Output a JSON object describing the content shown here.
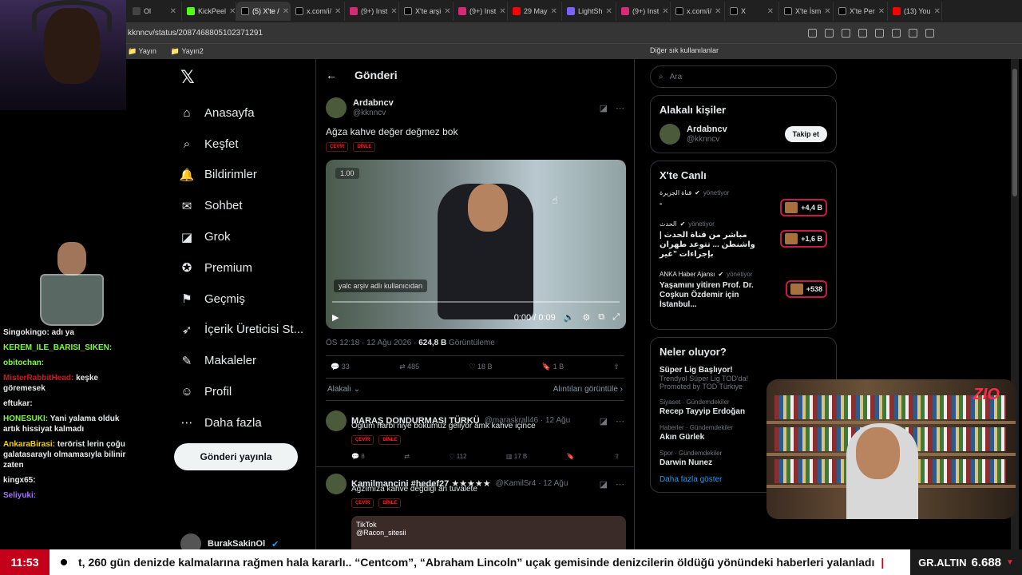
{
  "tabs": [
    {
      "label": "Ol",
      "color": "#444"
    },
    {
      "label": "KickPeel",
      "color": "#53fc18"
    },
    {
      "label": "(5) X'te /",
      "color": "#000",
      "active": true
    },
    {
      "label": "x.com/i/",
      "color": "#000"
    },
    {
      "label": "(9+) Inst",
      "color": "#d62976"
    },
    {
      "label": "X'te arşi",
      "color": "#000"
    },
    {
      "label": "(9+) Inst",
      "color": "#d62976"
    },
    {
      "label": "29 May",
      "color": "#ff0000"
    },
    {
      "label": "LightSh",
      "color": "#7b61ff"
    },
    {
      "label": "(9+) Inst",
      "color": "#d62976"
    },
    {
      "label": "x.com/i/",
      "color": "#000"
    },
    {
      "label": "X",
      "color": "#000"
    },
    {
      "label": "X'te İsm",
      "color": "#000"
    },
    {
      "label": "X'te Per",
      "color": "#000"
    },
    {
      "label": "(13) You",
      "color": "#ff0000"
    }
  ],
  "url": "kknncv/status/2087468805102371291",
  "bookmarks": [
    "Yayın",
    "Yayın2"
  ],
  "bookmarks_right": "Diğer sık kullanılanlar",
  "chat": [
    {
      "user": "Singokingo:",
      "text": "adı ya",
      "color": "#e7e9ea"
    },
    {
      "user": "KEREM_ILE_BARISI_SIKEN:",
      "text": "",
      "color": "#7dfc3a"
    },
    {
      "user": "obitochan:",
      "text": "",
      "color": "#7dfc3a"
    },
    {
      "user": "MisterRabbitHead:",
      "text": "keşke göremesek",
      "color": "#d0191f"
    },
    {
      "user": "eftukar:",
      "text": "",
      "color": "#e7e9ea"
    },
    {
      "user": "HONESUKI:",
      "text": "Yani yalama olduk artık hissiyat kalmadı",
      "color": "#7dfc3a"
    },
    {
      "user": "AnkaraBirasi:",
      "text": "terörist lerin çoğu galatasaraylı olmamasıyla bilinir zaten",
      "color": "#f5d000"
    },
    {
      "user": "kingx65:",
      "text": "",
      "color": "#e7e9ea"
    },
    {
      "user": "Seliyuki:",
      "text": "",
      "color": "#a970ff"
    }
  ],
  "nav": [
    {
      "label": "Anasayfa",
      "icon": "⌂",
      "name": "home"
    },
    {
      "label": "Keşfet",
      "icon": "⌕",
      "name": "explore"
    },
    {
      "label": "Bildirimler",
      "icon": "🔔",
      "name": "notifications"
    },
    {
      "label": "Sohbet",
      "icon": "✉",
      "name": "chat"
    },
    {
      "label": "Grok",
      "icon": "◪",
      "name": "grok"
    },
    {
      "label": "Premium",
      "icon": "✪",
      "name": "premium"
    },
    {
      "label": "Geçmiş",
      "icon": "⚑",
      "name": "history"
    },
    {
      "label": "İçerik Üreticisi St...",
      "icon": "➶",
      "name": "creator"
    },
    {
      "label": "Makaleler",
      "icon": "✎",
      "name": "articles"
    },
    {
      "label": "Profil",
      "icon": "☺",
      "name": "profile"
    },
    {
      "label": "Daha fazla",
      "icon": "⋯",
      "name": "more"
    }
  ],
  "post_button": "Gönderi yayınla",
  "account": {
    "name": "BurakSakinOl"
  },
  "page_title": "Gönderi",
  "tweet": {
    "name": "Ardabncv",
    "handle": "@kknncv",
    "text": "Ağza kahve değer değmez bok",
    "pills": [
      "ÇEVİR",
      "DİNLE"
    ],
    "speed": "1.00",
    "overlay": "yalc arşiv adlı kullanıcıdan",
    "time": "0:00 / 0:09",
    "date": "ÖS 12:18 · 12 Ağu 2026 ·",
    "views": "624,8 B",
    "views_label": "Görüntüleme",
    "stats": {
      "replies": "33",
      "retweets": "485",
      "likes": "18 B",
      "bookmarks": "1 B"
    },
    "sort": "Alakalı",
    "quotes": "Alıntıları görüntüle"
  },
  "replies": [
    {
      "name": "MARAŞ DONDURMASI TÜRKÜ",
      "handle": "@maraskrall46 · 12 Ağu",
      "text": "Oglum harbi niye bokumuz geliyor amk kahve içince",
      "stats": [
        "8",
        "",
        "112",
        "17 B"
      ]
    },
    {
      "name": "Kamilmancini #hedef27 ★★★★★",
      "handle": "@KamilSr4 · 12 Ağu",
      "text": "Ağzımıza kahve değdiği an tuvalete",
      "stats": [],
      "media": "TikTok",
      "media_handle": "@Racon_sitesii"
    }
  ],
  "search_placeholder": "Ara",
  "related": {
    "title": "Alakalı kişiler",
    "name": "Ardabncv",
    "handle": "@kknncv",
    "follow": "Takip et"
  },
  "live": {
    "title": "X'te Canlı",
    "items": [
      {
        "host": "قناة الجزيرة",
        "status": "yönetiyor",
        "text": "-",
        "count": "+4,4 B"
      },
      {
        "host": "الحدث",
        "status": "yönetiyor",
        "text": "مباشر من قناة الحدث | واشنطن ... تتوعد طهران بإجراءات \"غير",
        "count": "+1,6 B"
      },
      {
        "host": "ANKA Haber Ajansı",
        "status": "yönetiyor",
        "text": "Yaşamını yitiren Prof. Dr. Coşkun Özdemir için İstanbul...",
        "count": "+538"
      }
    ]
  },
  "trends": {
    "title": "Neler oluyor?",
    "items": [
      {
        "cat": "",
        "name": "Süper Lig Başlıyor!",
        "sub": "Trendyol Süper Lig TOD'da!",
        "promo": "Promoted by TOD Türkiye"
      },
      {
        "cat": "Siyaset · Gündemdekiler",
        "name": "Recep Tayyip Erdoğan",
        "sub": "",
        "promo": ""
      },
      {
        "cat": "Haberler · Gündemdekiler",
        "name": "Akın Gürlek",
        "sub": "",
        "promo": ""
      },
      {
        "cat": "Spor · Gündemdekiler",
        "name": "Darwin Nunez",
        "sub": "",
        "promo": ""
      }
    ],
    "more": "Daha fazla göster"
  },
  "stream_logo": "ZIO",
  "ticker": {
    "time": "11:53",
    "text": "t, 260 gün denizde kalmalarına rağmen hala kararlı.. “Centcom”, “Abraham Lincoln” uçak gemisinde denizcilerin öldüğü yönündeki haberleri yalanladı",
    "sep": "|",
    "gold_label": "GR.ALTIN",
    "gold_value": "6.688"
  }
}
